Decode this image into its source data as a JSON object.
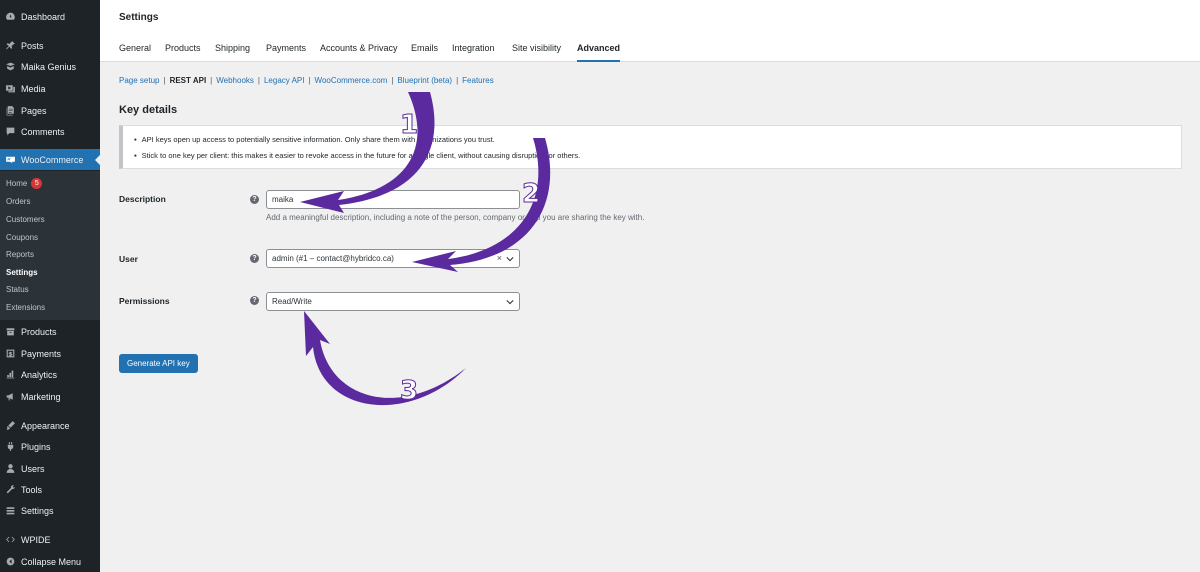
{
  "sidebar": {
    "items": [
      {
        "label": "Dashboard",
        "icon": "dashboard-icon"
      },
      {
        "label": "Posts",
        "icon": "pin-icon"
      },
      {
        "label": "Maika Genius",
        "icon": "genius-icon"
      },
      {
        "label": "Media",
        "icon": "media-icon"
      },
      {
        "label": "Pages",
        "icon": "pages-icon"
      },
      {
        "label": "Comments",
        "icon": "comments-icon"
      },
      {
        "label": "WooCommerce",
        "icon": "woocommerce-icon"
      },
      {
        "label": "Products",
        "icon": "products-icon"
      },
      {
        "label": "Payments",
        "icon": "payments-icon"
      },
      {
        "label": "Analytics",
        "icon": "analytics-icon"
      },
      {
        "label": "Marketing",
        "icon": "marketing-icon"
      },
      {
        "label": "Appearance",
        "icon": "appearance-icon"
      },
      {
        "label": "Plugins",
        "icon": "plugins-icon"
      },
      {
        "label": "Users",
        "icon": "users-icon"
      },
      {
        "label": "Tools",
        "icon": "tools-icon"
      },
      {
        "label": "Settings",
        "icon": "settings-icon"
      },
      {
        "label": "WPIDE",
        "icon": "code-icon"
      },
      {
        "label": "Collapse Menu",
        "icon": "collapse-icon"
      }
    ],
    "submenu": [
      {
        "label": "Home",
        "badge": "5"
      },
      {
        "label": "Orders"
      },
      {
        "label": "Customers"
      },
      {
        "label": "Coupons"
      },
      {
        "label": "Reports"
      },
      {
        "label": "Settings"
      },
      {
        "label": "Status"
      },
      {
        "label": "Extensions"
      }
    ]
  },
  "header": {
    "title": "Settings",
    "tabs": [
      "General",
      "Products",
      "Shipping",
      "Payments",
      "Accounts & Privacy",
      "Emails",
      "Integration",
      "Site visibility",
      "Advanced"
    ]
  },
  "subnav": [
    "Page setup",
    "REST API",
    "Webhooks",
    "Legacy API",
    "WooCommerce.com",
    "Blueprint (beta)",
    "Features"
  ],
  "section_title": "Key details",
  "notice": {
    "line1": "API keys open up access to potentially sensitive information. Only share them with organizations you trust.",
    "line2": "Stick to one key per client: this makes it easier to revoke access in the future for a single client, without causing disruption for others."
  },
  "form": {
    "description_label": "Description",
    "description_value": "maika",
    "description_help": "Add a meaningful description, including a note of the person, company or app you are sharing the key with.",
    "user_label": "User",
    "user_value": "admin (#1 – contact@hybridco.ca)",
    "user_clear": "×",
    "permissions_label": "Permissions",
    "permissions_value": "Read/Write",
    "help_tip": "?",
    "generate_label": "Generate API key"
  },
  "annotations": {
    "step1": "1",
    "step2": "2",
    "step3": "3",
    "arrow_color": "#5b2a9e"
  },
  "colors": {
    "sidebar_bg": "#1d2327",
    "accent": "#2271b1",
    "badge": "#d63638"
  }
}
